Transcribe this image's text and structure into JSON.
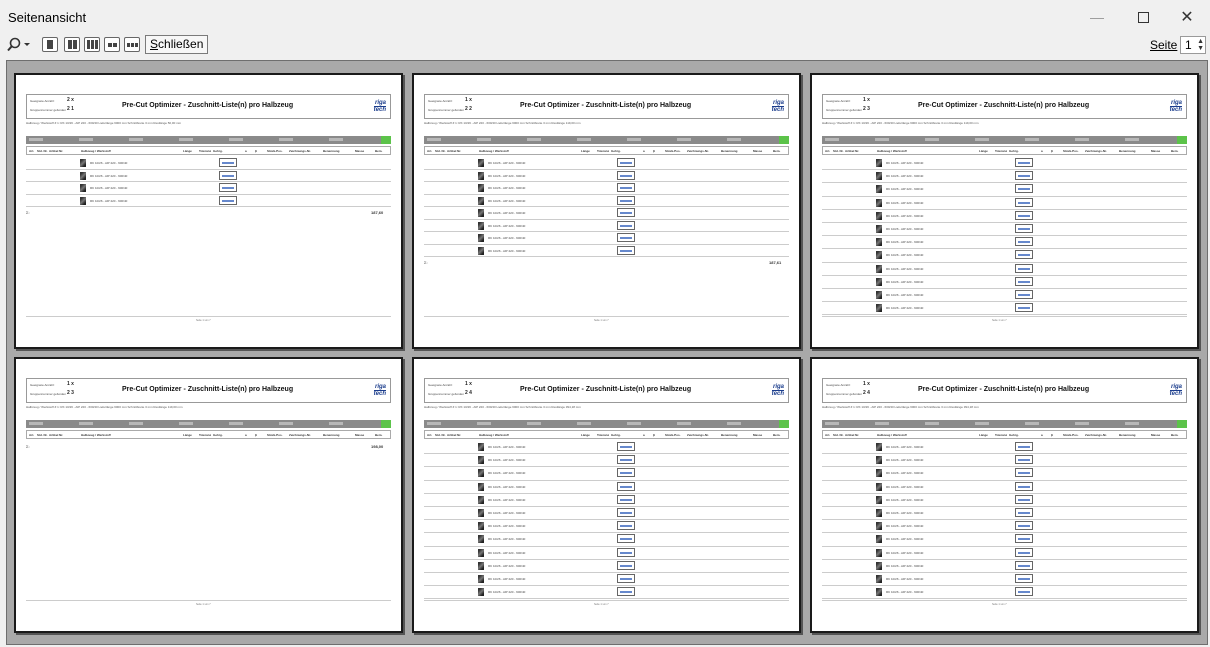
{
  "window": {
    "title": "Seitenansicht",
    "controls": {
      "minimize": "—",
      "close": "✕"
    }
  },
  "toolbar": {
    "zoom_icon": "magnifier-icon",
    "close_label_prefix": "S",
    "close_label_rest": "chließen",
    "page_label": "Seite",
    "page_value": "1"
  },
  "pages": [
    {
      "count_label": "Geeignete Anzahl:",
      "count_value": "2 x",
      "sheet_label": "Gruppennummer gefunden",
      "sheet_value": "2 1",
      "title": "Pre-Cut Optimizer - Zuschnitt-Liste(n) pro Halbzeug",
      "logo_top": "riga",
      "logo_bottom": "tech",
      "info": "Halbzeug / Werkstoff   # 1: RK 10/26 - AlP 220 - 600/40   Lieferlänge 6000 mm   Schnittbreite 3 mm   Restlänge 50,00 mm",
      "sum_label": "Σ:",
      "sum_value": "187,60",
      "row_count": 4
    },
    {
      "count_label": "Geeignete Anzahl:",
      "count_value": "1 x",
      "sheet_label": "Gruppennummer gefunden",
      "sheet_value": "2 2",
      "title": "Pre-Cut Optimizer - Zuschnitt-Liste(n) pro Halbzeug",
      "logo_top": "riga",
      "logo_bottom": "tech",
      "info": "Halbzeug / Werkstoff   # 1: RK 10/26 - AlP 220 - 600/40   Lieferlänge 6000 mm   Schnittbreite 3 mm   Restlänge 119,00 mm",
      "sum_label": "Σ:",
      "sum_value": "187,61",
      "row_count": 8
    },
    {
      "count_label": "Geeignete Anzahl:",
      "count_value": "1 x",
      "sheet_label": "Gruppennummer gefunden",
      "sheet_value": "2 3",
      "title": "Pre-Cut Optimizer - Zuschnitt-Liste(n) pro Halbzeug",
      "logo_top": "riga",
      "logo_bottom": "tech",
      "info": "Halbzeug / Werkstoff   # 1: RK 10/26 - AlP 220 - 600/40   Lieferlänge 6000 mm   Schnittbreite 3 mm   Restlänge 119,00 mm",
      "sum_label": "",
      "sum_value": "",
      "row_count": 12
    },
    {
      "count_label": "Geeignete Anzahl:",
      "count_value": "1 x",
      "sheet_label": "Gruppennummer gefunden",
      "sheet_value": "2 3",
      "title": "Pre-Cut Optimizer - Zuschnitt-Liste(n) pro Halbzeug",
      "logo_top": "riga",
      "logo_bottom": "tech",
      "info": "Halbzeug / Werkstoff   # 1: RK 10/26 - AlP 220 - 600/40   Lieferlänge 6000 mm   Schnittbreite 3 mm   Restlänge 119,00 mm",
      "sum_label": "Σ:",
      "sum_value": "198,00",
      "row_count": 0
    },
    {
      "count_label": "Geeignete Anzahl:",
      "count_value": "1 x",
      "sheet_label": "Gruppennummer gefunden",
      "sheet_value": "2 4",
      "title": "Pre-Cut Optimizer - Zuschnitt-Liste(n) pro Halbzeug",
      "logo_top": "riga",
      "logo_bottom": "tech",
      "info": "Halbzeug / Werkstoff   # 1: RK 10/26 - AlP 220 - 600/40   Lieferlänge 6000 mm   Schnittbreite 3 mm   Restlänge 394,18 mm",
      "sum_label": "",
      "sum_value": "",
      "row_count": 12
    },
    {
      "count_label": "Geeignete Anzahl:",
      "count_value": "1 x",
      "sheet_label": "Gruppennummer gefunden",
      "sheet_value": "2 4",
      "title": "Pre-Cut Optimizer - Zuschnitt-Liste(n) pro Halbzeug",
      "logo_top": "riga",
      "logo_bottom": "tech",
      "info": "Halbzeug / Werkstoff   # 1: RK 10/26 - AlP 220 - 600/40   Lieferlänge 6000 mm   Schnittbreite 3 mm   Restlänge 394,18 mm",
      "sum_label": "",
      "sum_value": "",
      "row_count": 12
    }
  ],
  "table_headers": [
    "Art.",
    "Std. Nr.",
    "Artikel Nr.",
    "Halbzeug / Werkstoff",
    "Länge",
    "Toleranz",
    "Gehrg.",
    "a",
    "β",
    "Stück-Pos.",
    "Zeichnungs-Nr.",
    "Benennung",
    "Masse",
    "Bem."
  ],
  "row_material": "RK 10/26 - AlP 220 - 600/40",
  "footer_page": "Seite 1 von 7"
}
